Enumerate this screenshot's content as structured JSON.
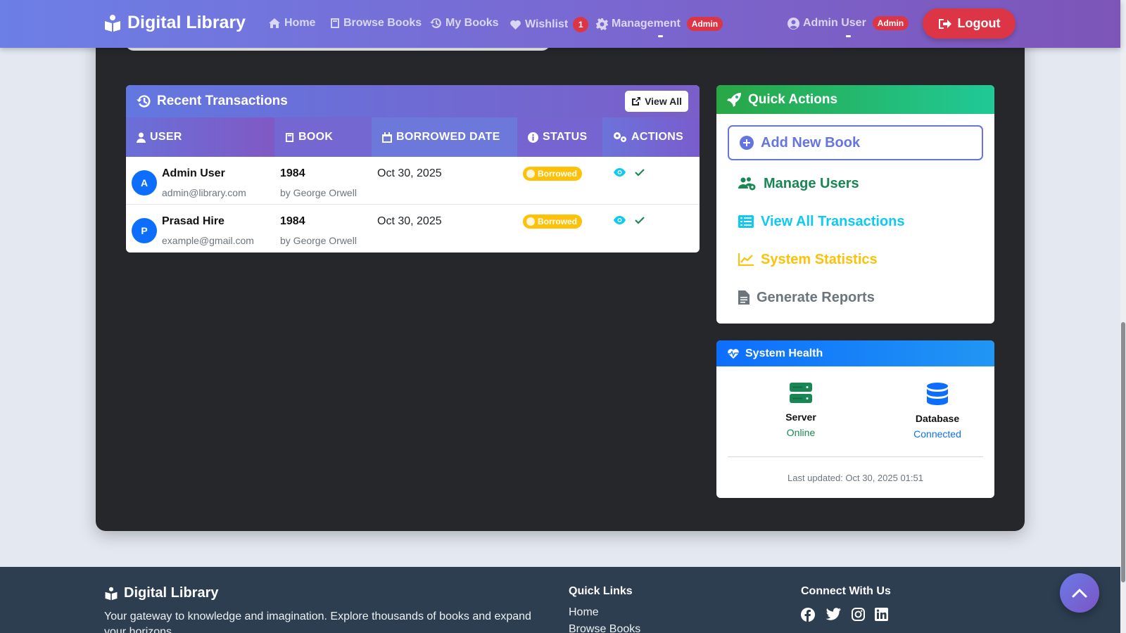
{
  "navbar": {
    "brand": "Digital Library",
    "links": [
      {
        "label": "Home",
        "icon": "home-icon"
      },
      {
        "label": "Browse Books",
        "icon": "book-icon"
      },
      {
        "label": "My Books",
        "icon": "history-icon"
      },
      {
        "label": "Wishlist",
        "icon": "heart-icon",
        "badge": "1"
      },
      {
        "label": "Management",
        "icon": "gear-icon",
        "badge": "Admin"
      }
    ],
    "user": {
      "label": "Admin User",
      "badge": "Admin",
      "icon": "user-circle-icon"
    },
    "logout_label": "Logout"
  },
  "transactions": {
    "title": "Recent Transactions",
    "view_all_label": "View All",
    "columns": [
      "USER",
      "BOOK",
      "BORROWED DATE",
      "STATUS",
      "ACTIONS"
    ],
    "rows": [
      {
        "initial": "A",
        "user_name": "Admin User",
        "user_email": "admin@library.com",
        "book_title": "1984",
        "book_author": "by George Orwell",
        "borrowed_date": "Oct 30, 2025",
        "status": "Borrowed"
      },
      {
        "initial": "P",
        "user_name": "Prasad Hire",
        "user_email": "example@gmail.com",
        "book_title": "1984",
        "book_author": "by George Orwell",
        "borrowed_date": "Oct 30, 2025",
        "status": "Borrowed"
      }
    ]
  },
  "quick_actions": {
    "title": "Quick Actions",
    "items": [
      {
        "label": "Add New Book",
        "icon": "plus-circle-icon",
        "color": "#6475e0"
      },
      {
        "label": "Manage Users",
        "icon": "users-gear-icon",
        "color": "#198754"
      },
      {
        "label": "View All Transactions",
        "icon": "list-icon",
        "color": "#0dcaf0"
      },
      {
        "label": "System Statistics",
        "icon": "chart-line-icon",
        "color": "#ffc107"
      },
      {
        "label": "Generate Reports",
        "icon": "file-icon",
        "color": "#6c757d"
      }
    ]
  },
  "system_health": {
    "title": "System Health",
    "server": {
      "label": "Server",
      "value": "Online",
      "color": "#198754"
    },
    "database": {
      "label": "Database",
      "value": "Connected",
      "color": "#0d6efd"
    },
    "last_updated": "Last updated: Oct 30, 2025 01:51"
  },
  "footer": {
    "brand": "Digital Library",
    "description": "Your gateway to knowledge and imagination. Explore thousands of books and expand your horizons.",
    "quick_links_title": "Quick Links",
    "quick_links": [
      "Home",
      "Browse Books"
    ],
    "connect_title": "Connect With Us",
    "social": [
      "facebook-icon",
      "twitter-icon",
      "instagram-icon",
      "linkedin-icon"
    ]
  },
  "colors": {
    "nav_gradient_start": "#6c7fe6",
    "nav_gradient_end": "#7d55b8",
    "logout": "#dc3545",
    "dark_panel": "#25272b",
    "footer": "#2c3e50",
    "status_borrowed": "#ffc107"
  }
}
